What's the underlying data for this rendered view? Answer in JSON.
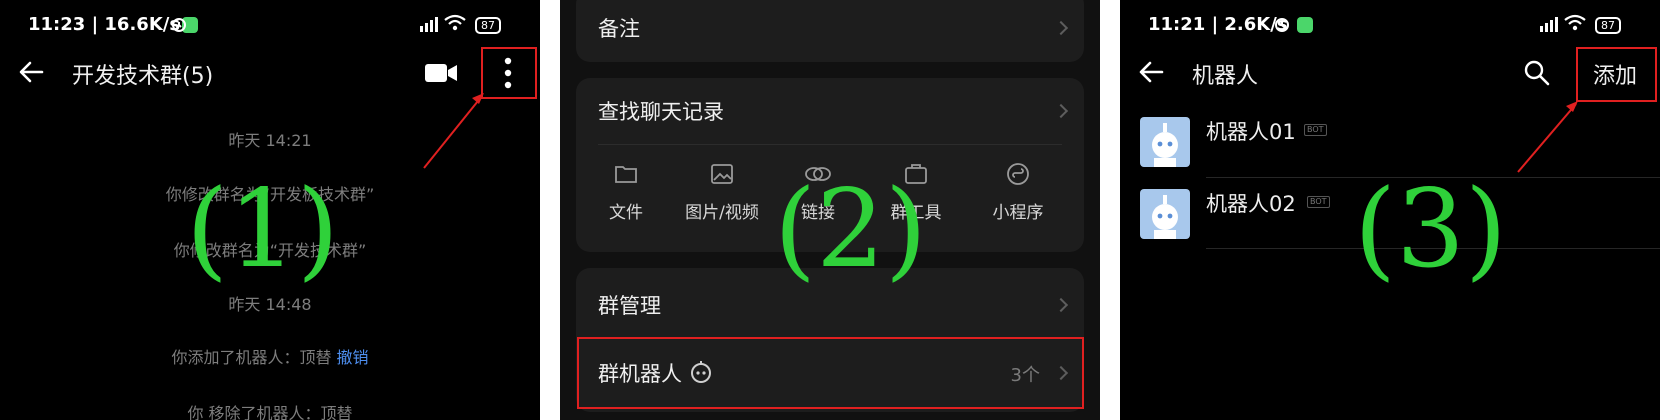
{
  "panel1": {
    "status": {
      "time": "11:23 | 16.6K/s",
      "battery": "87"
    },
    "title": "开发技术群(5)",
    "messages": {
      "m1": "昨天  14:21",
      "m2": "你修改群名为“开发板技术群”",
      "m3": "你修改群名为“开发技术群”",
      "m4": "昨天  14:48",
      "m5_text": "你添加了机器人：顶替",
      "m5_link": "撤销",
      "m6": "你 移除了机器人：顶替"
    },
    "annotation": "(1)"
  },
  "panel2": {
    "remark_label": "备注",
    "search_history_label": "查找聊天记录",
    "tools": [
      "文件",
      "图片/视频",
      "链接",
      "群工具",
      "小程序"
    ],
    "group_manage_label": "群管理",
    "group_robot_label": "群机器人",
    "group_robot_count": "3个",
    "annotation": "(2)"
  },
  "panel3": {
    "status": {
      "time": "11:21 | 2.6K/s",
      "battery": "87"
    },
    "title": "机器人",
    "add_label": "添加",
    "bots": [
      {
        "name": "机器人01",
        "tag": "BOT"
      },
      {
        "name": "机器人02",
        "tag": "BOT"
      }
    ],
    "annotation": "(3)"
  },
  "colors": {
    "annotation_green": "#2fd13a",
    "highlight_red": "#e02020",
    "link_blue": "#4e8ff0"
  }
}
